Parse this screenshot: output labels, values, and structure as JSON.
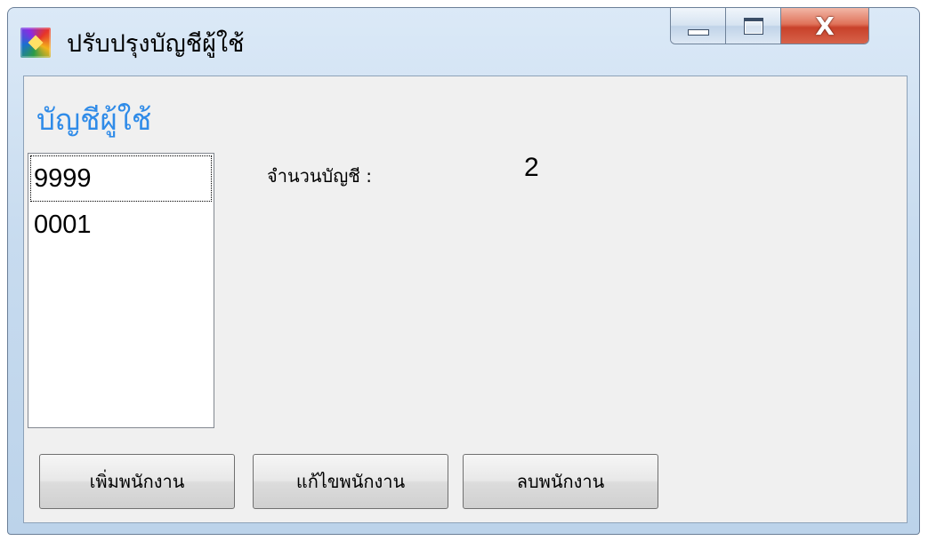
{
  "window": {
    "title": "ปรับปรุงบัญชีผู้ใช้",
    "icon": "app-icon",
    "controls": {
      "minimize": "minimize-icon",
      "maximize": "maximize-icon",
      "close": "X"
    }
  },
  "main": {
    "heading": "บัญชีผู้ใช้",
    "accounts": [
      {
        "label": "9999"
      },
      {
        "label": "0001"
      }
    ],
    "count_label": "จำนวนบัญชี :",
    "count_value": "2"
  },
  "buttons": {
    "add": "เพิ่มพนักงาน",
    "edit": "แก้ไขพนักงาน",
    "delete": "ลบพนักงาน"
  },
  "colors": {
    "heading": "#2f8be8",
    "client_bg": "#f0f0f0",
    "frame": "#c7dbef",
    "close_button": "#c8412a"
  }
}
